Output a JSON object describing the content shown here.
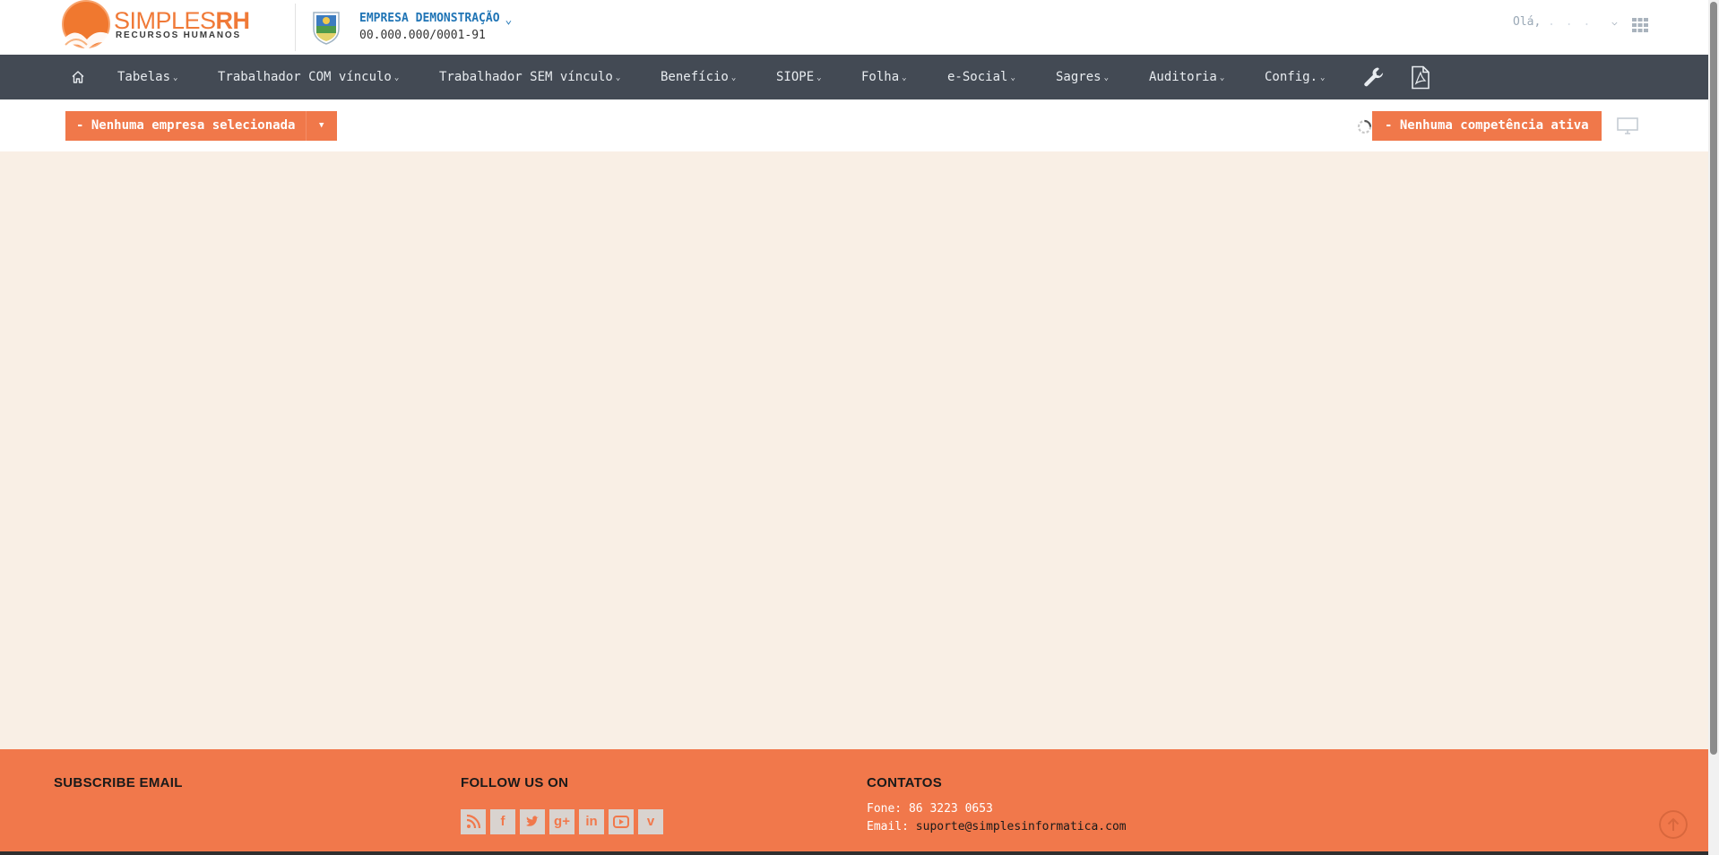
{
  "header": {
    "logo": {
      "brand_light": "SIMPLES",
      "brand_bold": "RH",
      "subtitle": "RECURSOS HUMANOS"
    },
    "company": {
      "name": "EMPRESA DEMONSTRAÇÃO",
      "cnpj": "00.000.000/0001-91",
      "chevron_icon": "chevron-down-icon"
    },
    "user": {
      "greeting": "Olá,",
      "name": ". . .",
      "chevron_icon": "chevron-down-icon"
    },
    "apps_icon": "grid-icon"
  },
  "nav": {
    "home_icon": "home-icon",
    "items": [
      {
        "label": "Tabelas"
      },
      {
        "label": "Trabalhador COM vínculo"
      },
      {
        "label": "Trabalhador SEM vínculo"
      },
      {
        "label": "Benefício"
      },
      {
        "label": "SIOPE"
      },
      {
        "label": "Folha"
      },
      {
        "label": "e-Social"
      },
      {
        "label": "Sagres"
      },
      {
        "label": "Auditoria"
      },
      {
        "label": "Config."
      }
    ],
    "tools_icon": "wrench-icon",
    "pdf_icon": "pdf-icon"
  },
  "toolbar": {
    "company_select": "- Nenhuma empresa selecionada",
    "competence": "- Nenhuma competência ativa",
    "monitor_icon": "monitor-icon"
  },
  "footer": {
    "subscribe_title": "SUBSCRIBE EMAIL",
    "follow_title": "FOLLOW US ON",
    "social": [
      {
        "name": "rss-icon",
        "glyph": ""
      },
      {
        "name": "facebook-icon",
        "glyph": "f"
      },
      {
        "name": "twitter-icon",
        "glyph": ""
      },
      {
        "name": "google-plus-icon",
        "glyph": "g+"
      },
      {
        "name": "linkedin-icon",
        "glyph": "in"
      },
      {
        "name": "youtube-icon",
        "glyph": ""
      },
      {
        "name": "vimeo-icon",
        "glyph": "v"
      }
    ],
    "contacts_title": "CONTATOS",
    "phone_label": "Fone:",
    "phone": "86 3223 0653",
    "email_label": "Email:",
    "email": "suporte@simplesinformatica.com"
  },
  "colors": {
    "accent": "#f0784a",
    "navbar": "#434a54",
    "content_bg": "#f9efe5",
    "company_link": "#1f74b5"
  }
}
